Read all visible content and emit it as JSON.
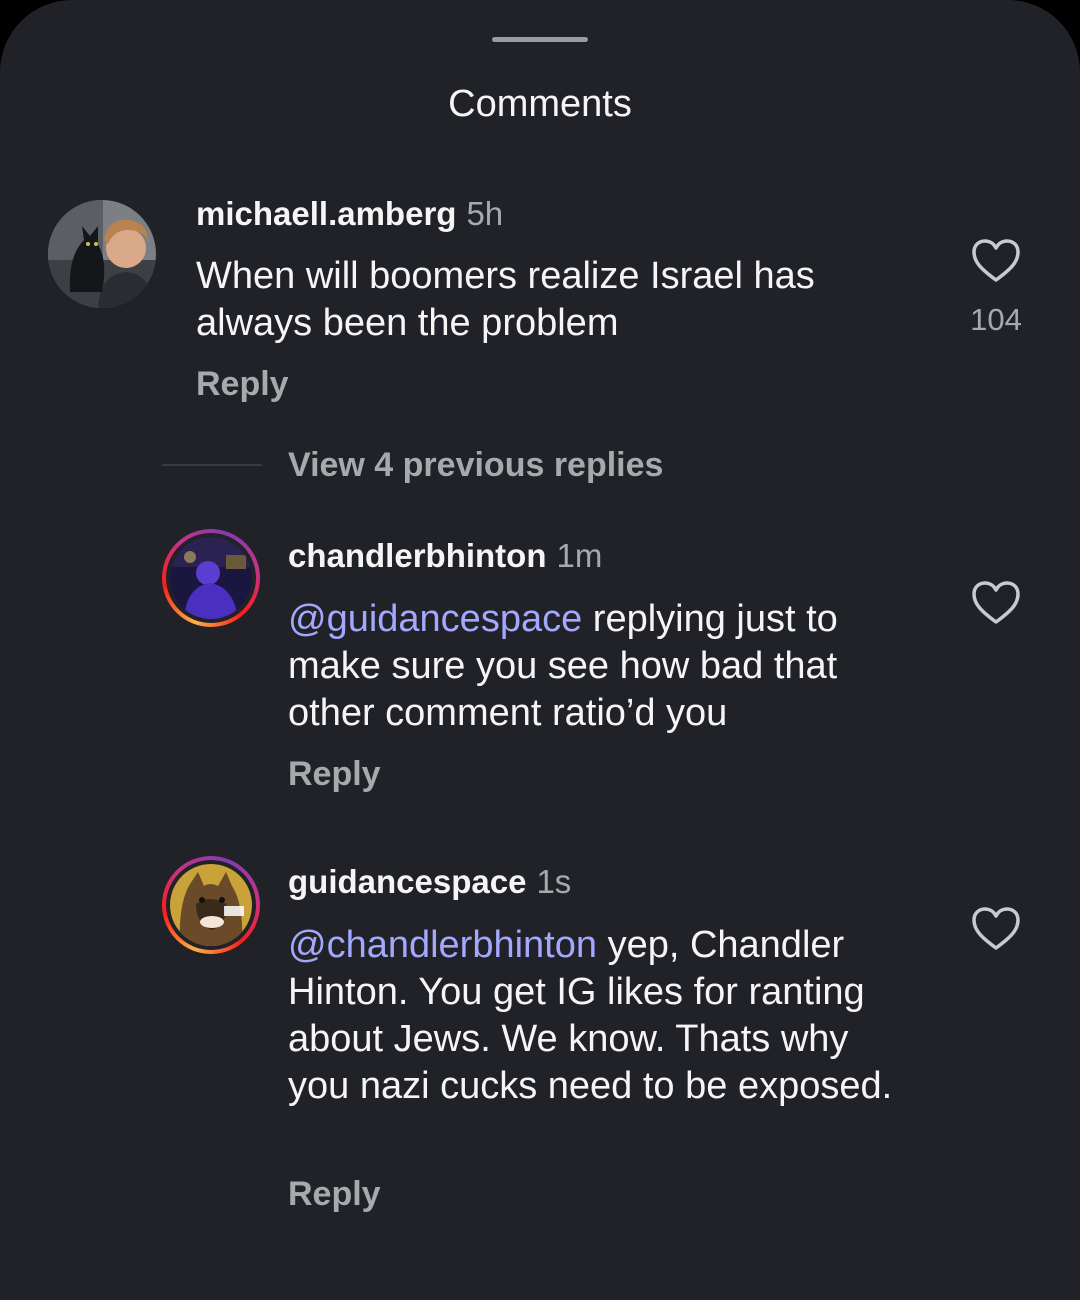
{
  "sheet": {
    "title": "Comments"
  },
  "comments": [
    {
      "username": "michaell.amberg",
      "time": "5h",
      "text": "When will boomers realize Israel has always been the problem",
      "reply_label": "Reply",
      "like_count": "104"
    }
  ],
  "view_replies": {
    "label": "View 4 previous replies"
  },
  "replies": [
    {
      "username": "chandlerbhinton",
      "time": "1m",
      "mention": "@guidancespace",
      "text": "replying just to make sure you see how bad that other comment ratio’d you",
      "reply_label": "Reply"
    },
    {
      "username": "guidancespace",
      "time": "1s",
      "mention": "@chandlerbhinton",
      "text": "yep, Chandler Hinton. You get IG likes for ranting about Jews. We know. Thats why you nazi cucks need to be exposed.",
      "reply_label": "Reply"
    }
  ],
  "colors": {
    "background": "#212227",
    "mention": "#a3a8ff",
    "secondary_text": "#a8a9ad"
  },
  "icons": {
    "like": "heart-outline-icon",
    "mention": "threads-at-icon"
  }
}
